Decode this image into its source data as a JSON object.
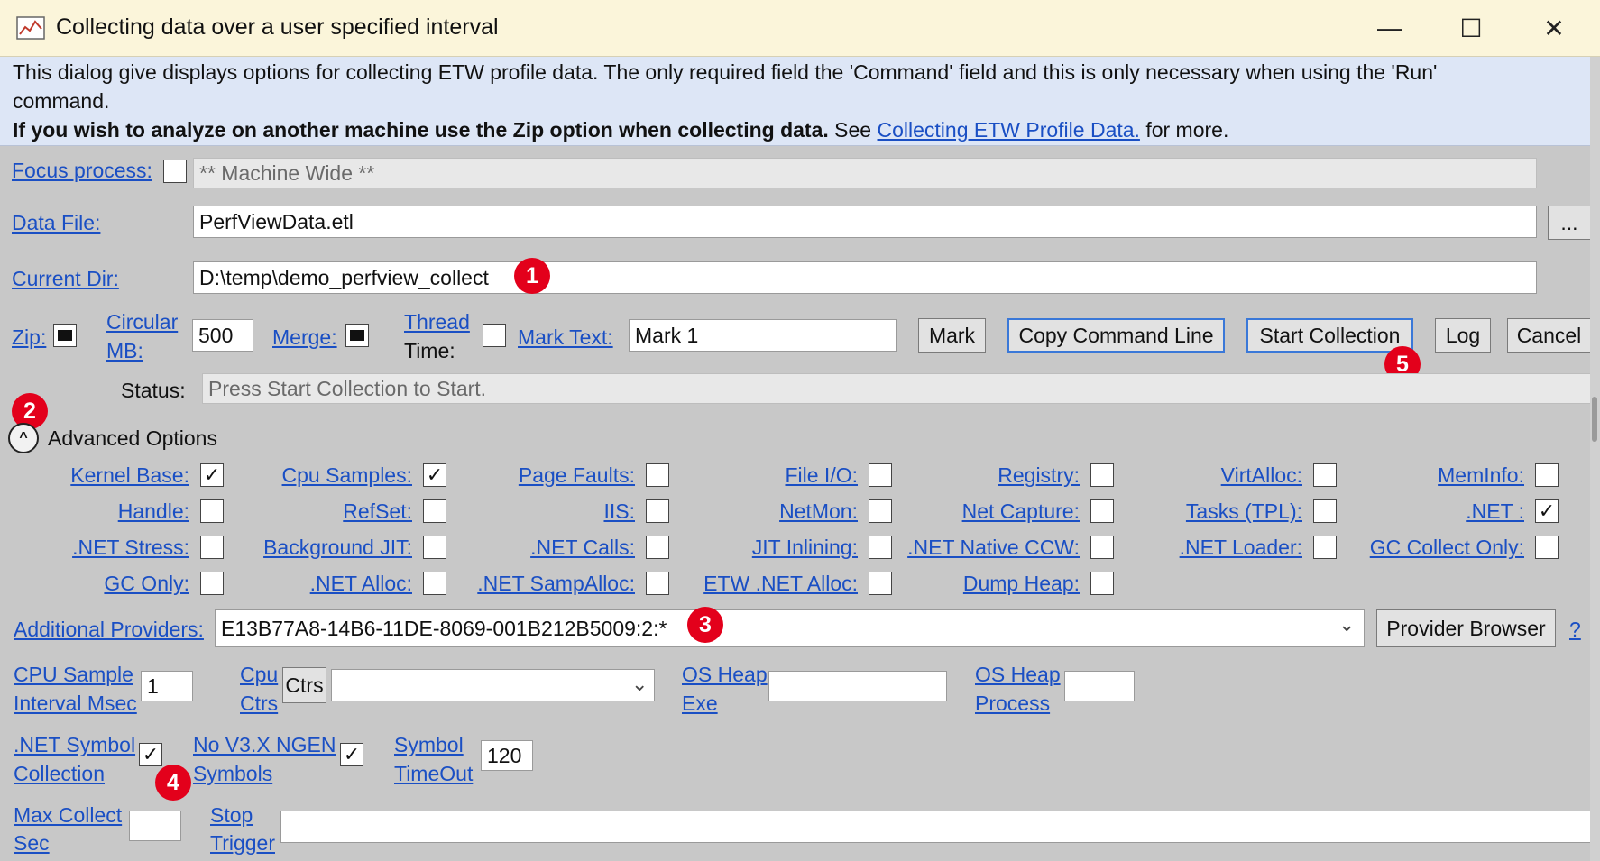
{
  "window": {
    "title": "Collecting data over a user specified interval",
    "minimize": "—",
    "maximize": "☐",
    "close": "✕"
  },
  "info": {
    "line1": "This dialog give displays options for collecting ETW profile data. The only required field the 'Command' field and this is only necessary when using the 'Run'",
    "line2": "command.",
    "line3_bold": "If you wish to analyze on another machine use the Zip option when collecting data.",
    "line3_see": " See ",
    "line3_link": "Collecting ETW Profile Data.",
    "line3_end": " for more."
  },
  "focus": {
    "label": "Focus process:",
    "value": "** Machine Wide **"
  },
  "datafile": {
    "label": "Data File:",
    "value": "PerfViewData.etl",
    "browse": "..."
  },
  "curdir": {
    "label": "Current Dir:",
    "value": "D:\\temp\\demo_perfview_collect"
  },
  "row4": {
    "zip": "Zip:",
    "circular1": "Circular",
    "circular2": "MB:",
    "circular_value": "500",
    "merge": "Merge:",
    "thread1": "Thread",
    "thread2": "Time:",
    "marktext": "Mark Text:",
    "marktext_value": "Mark 1",
    "mark_btn": "Mark",
    "copy_btn": "Copy Command Line",
    "start_btn": "Start Collection",
    "log_btn": "Log",
    "cancel_btn": "Cancel"
  },
  "status": {
    "label": "Status:",
    "value": "Press Start Collection to Start."
  },
  "advanced": {
    "label": "Advanced Options"
  },
  "options": [
    {
      "label": "Kernel Base:",
      "checked": true
    },
    {
      "label": "Cpu Samples:",
      "checked": true
    },
    {
      "label": "Page Faults:",
      "checked": false
    },
    {
      "label": "File I/O:",
      "checked": false
    },
    {
      "label": "Registry:",
      "checked": false
    },
    {
      "label": "VirtAlloc:",
      "checked": false
    },
    {
      "label": "MemInfo:",
      "checked": false
    },
    {
      "label": "Handle:",
      "checked": false
    },
    {
      "label": "RefSet:",
      "checked": false
    },
    {
      "label": "IIS:",
      "checked": false
    },
    {
      "label": "NetMon:",
      "checked": false
    },
    {
      "label": "Net Capture:",
      "checked": false
    },
    {
      "label": "Tasks (TPL):",
      "checked": false
    },
    {
      "label": ".NET :",
      "checked": true
    },
    {
      "label": ".NET Stress:",
      "checked": false
    },
    {
      "label": "Background JIT:",
      "checked": false
    },
    {
      "label": ".NET Calls:",
      "checked": false
    },
    {
      "label": "JIT Inlining:",
      "checked": false
    },
    {
      "label": ".NET Native CCW:",
      "checked": false
    },
    {
      "label": ".NET Loader:",
      "checked": false
    },
    {
      "label": "GC Collect Only:",
      "checked": false
    },
    {
      "label": "GC Only:",
      "checked": false
    },
    {
      "label": ".NET Alloc:",
      "checked": false
    },
    {
      "label": ".NET SampAlloc:",
      "checked": false
    },
    {
      "label": "ETW .NET Alloc:",
      "checked": false
    },
    {
      "label": "Dump Heap:",
      "checked": false
    }
  ],
  "providers": {
    "label": "Additional Providers:",
    "value": "E13B77A8-14B6-11DE-8069-001B212B5009:2:*",
    "browser_btn": "Provider Browser",
    "help": "?"
  },
  "cpu": {
    "sample1": "CPU Sample",
    "sample2": "Interval Msec",
    "sample_value": "1",
    "ctrs1": "Cpu",
    "ctrs2": "Ctrs",
    "ctrs_btn": "Ctrs",
    "osheap_exe1": "OS Heap",
    "osheap_exe2": "Exe",
    "osheap_proc1": "OS Heap",
    "osheap_proc2": "Process"
  },
  "symbols": {
    "net1": ".NET Symbol",
    "net2": "Collection",
    "nov3_1": "No V3.X NGEN",
    "nov3_2": "Symbols",
    "timeout1": "Symbol",
    "timeout2": "TimeOut",
    "timeout_value": "120"
  },
  "collect": {
    "max1": "Max Collect",
    "max2": "Sec",
    "stop1": "Stop",
    "stop2": "Trigger"
  },
  "badges": [
    "1",
    "2",
    "3",
    "4",
    "5"
  ],
  "icons": {
    "check": "✓",
    "dropdown": "⌄",
    "expander": "^"
  }
}
